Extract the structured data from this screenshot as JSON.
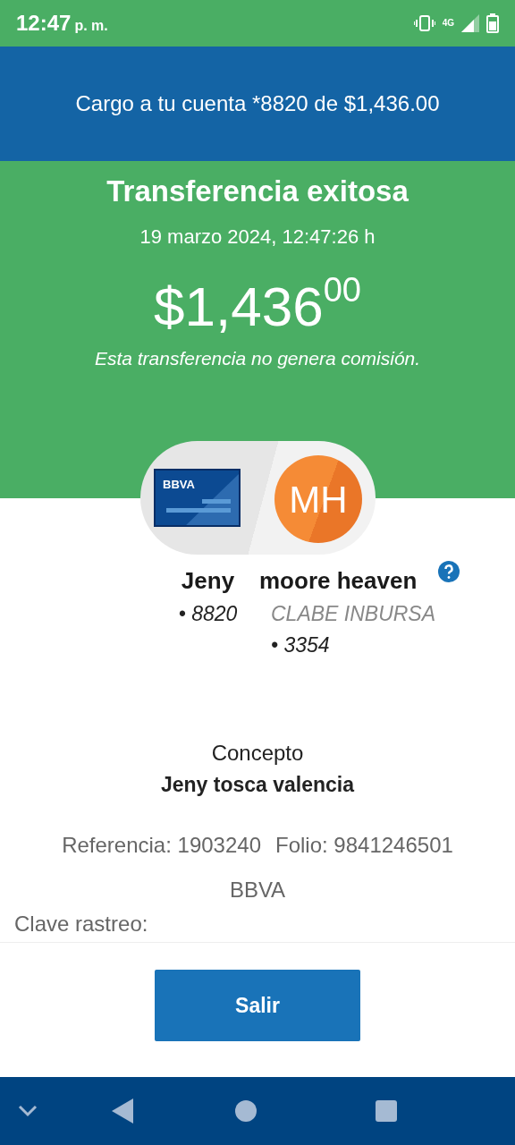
{
  "status_bar": {
    "time": "12:47",
    "ampm": "p. m.",
    "network": "4G"
  },
  "banner": {
    "text": "Cargo a tu cuenta *8820 de $1,436.00"
  },
  "result": {
    "title": "Transferencia exitosa",
    "date": "19 marzo 2024, 12:47:26 h",
    "amount": "$1,436$^{00}$",
    "note": "Esta transferencia no genera comisión."
  },
  "transfer": {
    "card_logo": "BBVA",
    "avatar": "MH",
    "sender": {
      "name": "Jeny",
      "account": "• 8820"
    },
    "receiver": {
      "name": "moore heaven",
      "bank": "CLABE INBURSA",
      "account": "• 3354"
    }
  },
  "details": {
    "concept_label": "Concepto",
    "concept": "Jeny tosca valencia",
    "reference": "Referencia: 1903240",
    "folio": "Folio: 9841246501",
    "bank": "BBVA",
    "tracking_label": "Clave rastreo:"
  },
  "button": "Salir"
}
